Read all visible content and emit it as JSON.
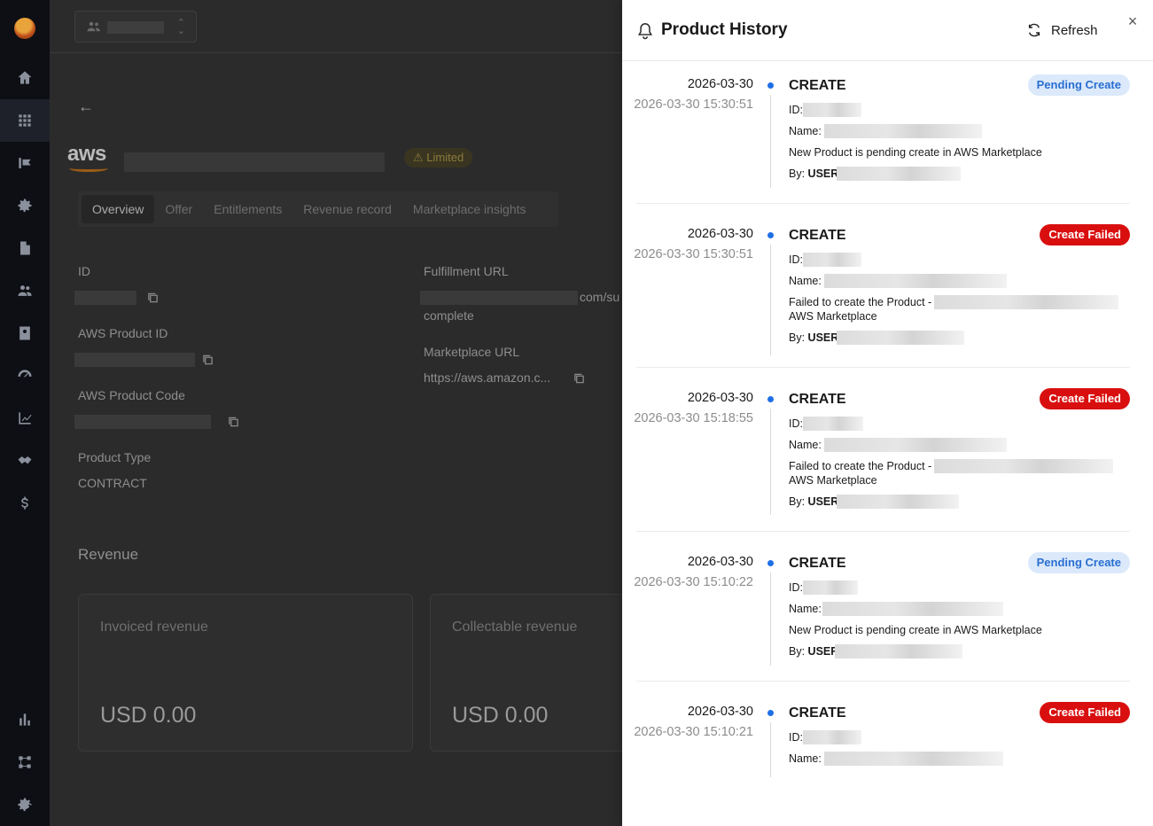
{
  "app": {
    "section": "Product Detail"
  },
  "colors": {
    "accent": "#1f6fe6",
    "danger": "#d90f0f",
    "pending_bg": "#dbe9fb",
    "pending_text": "#2a6fd1"
  },
  "sidebar": {
    "items": [
      {
        "icon": "home-icon"
      },
      {
        "icon": "grid-icon",
        "active": true
      },
      {
        "icon": "flag-icon"
      },
      {
        "icon": "gear-icon"
      },
      {
        "icon": "document-icon"
      },
      {
        "icon": "users-icon"
      },
      {
        "icon": "contact-card-icon"
      },
      {
        "icon": "gauge-icon"
      },
      {
        "icon": "chart-line-icon"
      },
      {
        "icon": "handshake-icon"
      },
      {
        "icon": "dollar-icon"
      },
      {
        "icon": "bar-chart-icon"
      },
      {
        "icon": "workflow-icon"
      },
      {
        "icon": "settings-icon"
      }
    ]
  },
  "product": {
    "logo_text": "aws",
    "limited_label": "⚠ Limited",
    "tabs": [
      "Overview",
      "Offer",
      "Entitlements",
      "Revenue record",
      "Marketplace insights"
    ],
    "fields": {
      "id_label": "ID",
      "aws_product_id_label": "AWS Product ID",
      "aws_product_code_label": "AWS Product Code",
      "product_type_label": "Product Type",
      "product_type_value": "CONTRACT",
      "fulfillment_url_label": "Fulfillment URL",
      "fulfillment_url_tail": "com/su",
      "fulfillment_url_line2": "complete",
      "marketplace_url_label": "Marketplace URL",
      "marketplace_url_value": "https://aws.amazon.c..."
    },
    "revenue": {
      "title": "Revenue",
      "cards": [
        {
          "label": "Invoiced revenue",
          "amount": "USD 0.00"
        },
        {
          "label": "Collectable revenue",
          "amount": "USD 0.00"
        }
      ]
    }
  },
  "drawer": {
    "title": "Product History",
    "refresh_label": "Refresh",
    "close_label": "×",
    "entries": [
      {
        "date": "2026-03-30",
        "time": "2026-03-30 15:30:51",
        "action": "CREATE",
        "status": "Pending Create",
        "status_type": "pending",
        "id_label": "ID:",
        "name_label": "Name:",
        "message": "New Product is pending create in AWS Marketplace",
        "message2": "",
        "by_label": "By:",
        "by_user": "USER"
      },
      {
        "date": "2026-03-30",
        "time": "2026-03-30 15:30:51",
        "action": "CREATE",
        "status": "Create Failed",
        "status_type": "failed",
        "id_label": "ID:",
        "name_label": "Name:",
        "message": "Failed to create the Product -",
        "message2": "AWS Marketplace",
        "by_label": "By:",
        "by_user": "USER"
      },
      {
        "date": "2026-03-30",
        "time": "2026-03-30 15:18:55",
        "action": "CREATE",
        "status": "Create Failed",
        "status_type": "failed",
        "id_label": "ID:",
        "name_label": "Name:",
        "message": "Failed to create the Product -",
        "message2": "AWS Marketplace",
        "by_label": "By:",
        "by_user": "USER"
      },
      {
        "date": "2026-03-30",
        "time": "2026-03-30 15:10:22",
        "action": "CREATE",
        "status": "Pending Create",
        "status_type": "pending",
        "id_label": "ID:",
        "name_label": "Name:",
        "message": "New Product is pending create in AWS Marketplace",
        "message2": "",
        "by_label": "By:",
        "by_user": "USER"
      },
      {
        "date": "2026-03-30",
        "time": "2026-03-30 15:10:21",
        "action": "CREATE",
        "status": "Create Failed",
        "status_type": "failed",
        "id_label": "ID:",
        "name_label": "Name:",
        "message": "",
        "message2": "",
        "by_label": "",
        "by_user": ""
      }
    ]
  }
}
